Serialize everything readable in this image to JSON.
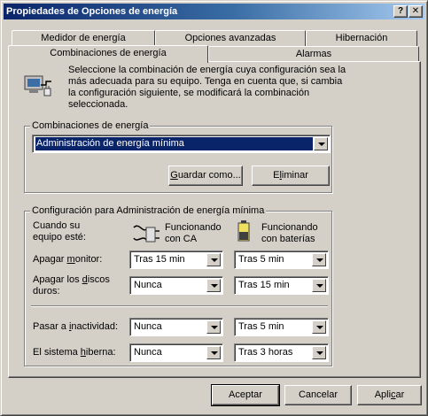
{
  "window": {
    "title": "Propiedades de Opciones de energía",
    "help_label": "?",
    "close_label": "✕"
  },
  "tabs": {
    "row_back": [
      "Medidor de energía",
      "Opciones avanzadas",
      "Hibernación"
    ],
    "row_front": [
      "Combinaciones de energía",
      "Alarmas"
    ]
  },
  "intro": {
    "text": "Seleccione la combinación de energía  cuya configuración sea la más adecuada para su equipo. Tenga en cuenta que, si cambia la configuración siguiente, se modificará la combinación seleccionada."
  },
  "schemes": {
    "group_label": "Combinaciones de energía",
    "selected": "Administración de energía mínima",
    "save_as_pre": "G",
    "save_as_post": "uardar como...",
    "delete_pre": "E",
    "delete_ul": "l",
    "delete_post": "iminar"
  },
  "settings": {
    "group_label": "Configuración para Administración de energía mínima",
    "when_label": "Cuando su equipo esté:",
    "ac_header": "Funcionando con CA",
    "battery_header": "Funcionando con baterías",
    "rows": [
      {
        "label_pre": "Apagar ",
        "label_ul": "m",
        "label_post": "onitor:",
        "ac": "Tras 15 min",
        "battery": "Tras 5 min"
      },
      {
        "label_pre": "Apagar los ",
        "label_ul": "d",
        "label_post": "iscos duros:",
        "ac": "Nunca",
        "battery": "Tras 15 min"
      },
      {
        "label_pre": "Pasar a ",
        "label_ul": "i",
        "label_post": "nactividad:",
        "ac": "Nunca",
        "battery": "Tras 5 min"
      },
      {
        "label_pre": "El sistema ",
        "label_ul": "h",
        "label_post": "iberna:",
        "ac": "Nunca",
        "battery": "Tras 3 horas"
      }
    ]
  },
  "footer": {
    "ok": "Aceptar",
    "cancel": "Cancelar",
    "apply_pre": "Apli",
    "apply_ul": "c",
    "apply_post": "ar"
  },
  "colors": {
    "title_start": "#0a246a",
    "title_end": "#a6caf0",
    "face": "#d4d0c8",
    "selection": "#0a246a"
  }
}
